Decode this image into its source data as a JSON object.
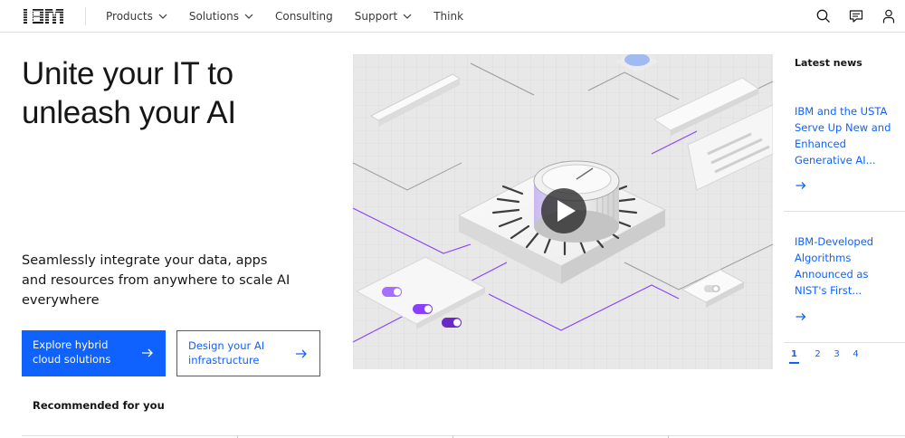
{
  "header": {
    "logo_text": "IBM",
    "nav": [
      {
        "label": "Products",
        "has_menu": true
      },
      {
        "label": "Solutions",
        "has_menu": true
      },
      {
        "label": "Consulting",
        "has_menu": false
      },
      {
        "label": "Support",
        "has_menu": true
      },
      {
        "label": "Think",
        "has_menu": false
      }
    ],
    "icons": [
      "search-icon",
      "chat-icon",
      "user-icon"
    ]
  },
  "hero": {
    "title": "Unite your IT to unleash your AI",
    "subtitle": "Seamlessly integrate your data, apps and resources from anywhere to scale AI everywhere",
    "primary_cta": "Explore hybrid cloud solutions",
    "secondary_cta": "Design your AI infrastructure",
    "media_icon": "play-icon"
  },
  "recommended": {
    "title": "Recommended for you"
  },
  "news": {
    "title": "Latest news",
    "items": [
      {
        "title": "IBM and the USTA Serve Up New and Enhanced Generative AI..."
      },
      {
        "title": "IBM-Developed Algorithms Announced as NIST's First..."
      }
    ],
    "pages": [
      "1",
      "2",
      "3",
      "4"
    ],
    "active_page": "1"
  },
  "colors": {
    "accent": "#0f62fe",
    "text": "#161616",
    "border": "#e0e0e0",
    "illustration_purple": "#8a3ffc"
  }
}
